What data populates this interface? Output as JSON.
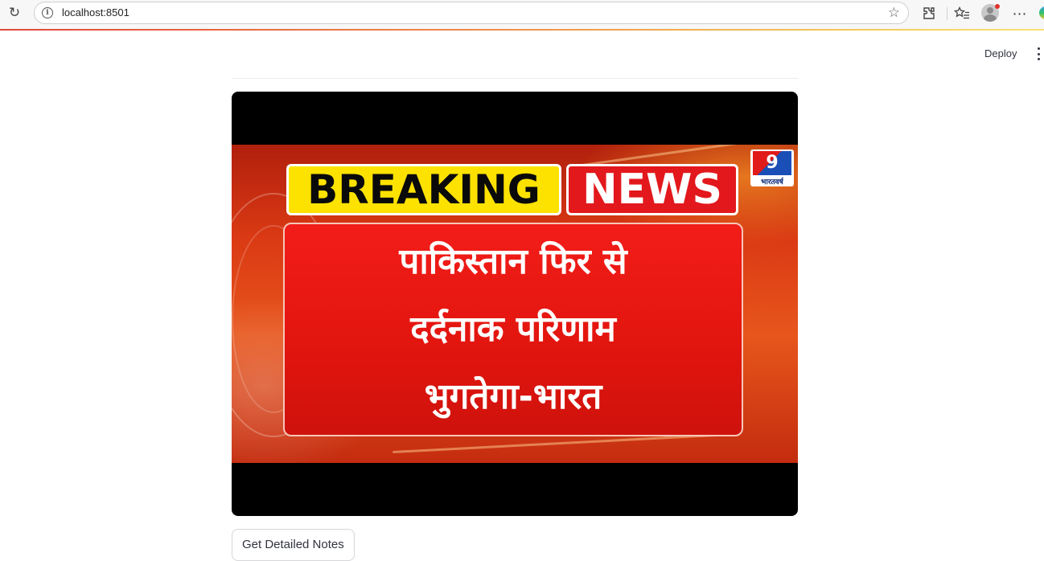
{
  "browser": {
    "url": "localhost:8501",
    "icons": [
      "reload-icon",
      "info-icon",
      "star-icon",
      "extensions-icon",
      "favorites-icon",
      "profile-avatar",
      "more-icon"
    ]
  },
  "header": {
    "deploy_label": "Deploy"
  },
  "video": {
    "badge_breaking": "BREAKING",
    "badge_news": "NEWS",
    "logo_text": "9",
    "logo_subtext": "भारतवर्ष",
    "headline_lines": [
      "पाकिस्तान फिर से",
      "दर्दनाक परिणाम",
      "भुगतेगा-भारत"
    ]
  },
  "actions": {
    "notes_button_label": "Get Detailed Notes"
  },
  "colors": {
    "accent_line_start": "#e1493a",
    "breaking_yellow": "#fde200",
    "news_red": "#e2181d"
  }
}
